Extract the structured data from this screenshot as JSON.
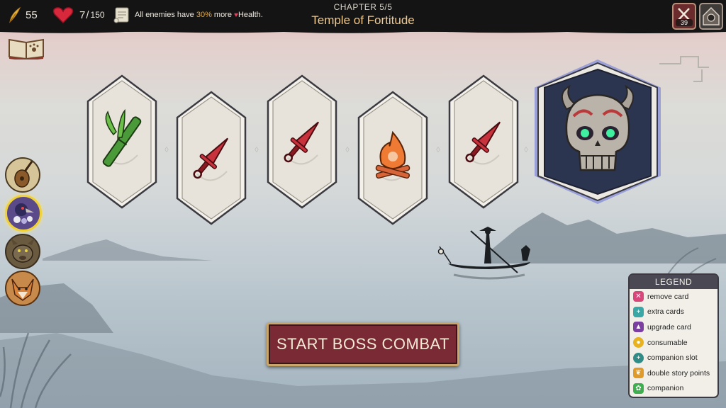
{
  "hud": {
    "story_points": "55",
    "health_current": "7",
    "health_sep": "/",
    "health_max": "150",
    "notice_prefix": "All enemies have ",
    "notice_highlight": "30%",
    "notice_suffix": " more ",
    "notice_heart": "♥",
    "notice_end": "Health.",
    "remove_count": "39"
  },
  "chapter": {
    "label": "CHAPTER 5/5",
    "title": "Temple of Fortitude"
  },
  "path": {
    "nodes": [
      {
        "name": "bamboo-node",
        "icon": "bamboo-icon"
      },
      {
        "name": "dagger-node-1",
        "icon": "dagger-icon"
      },
      {
        "name": "dagger-node-2",
        "icon": "dagger-icon"
      },
      {
        "name": "campfire-node",
        "icon": "campfire-icon"
      },
      {
        "name": "dagger-node-3",
        "icon": "dagger-icon"
      },
      {
        "name": "boss-node",
        "icon": "demon-skull-icon"
      }
    ]
  },
  "start_button": {
    "label": "START BOSS COMBAT"
  },
  "legend": {
    "title": "LEGEND",
    "items": [
      {
        "label": "remove card",
        "icon": "remove-card-icon",
        "color": "#d9467a"
      },
      {
        "label": "extra cards",
        "icon": "extra-cards-icon",
        "color": "#3aa6a6"
      },
      {
        "label": "upgrade card",
        "icon": "upgrade-card-icon",
        "color": "#7a3fa0"
      },
      {
        "label": "consumable",
        "icon": "consumable-icon",
        "color": "#e8b21f"
      },
      {
        "label": "companion slot",
        "icon": "companion-slot-icon",
        "color": "#2f8c86"
      },
      {
        "label": "double story points",
        "icon": "feather-icon",
        "color": "#e09a2a"
      },
      {
        "label": "companion",
        "icon": "paw-icon",
        "color": "#3fae4f"
      }
    ]
  },
  "colors": {
    "accent_gold": "#f2c98c",
    "button_red": "#7a2a35",
    "boss_border": "#8f97d8",
    "health_red": "#d8283c"
  }
}
